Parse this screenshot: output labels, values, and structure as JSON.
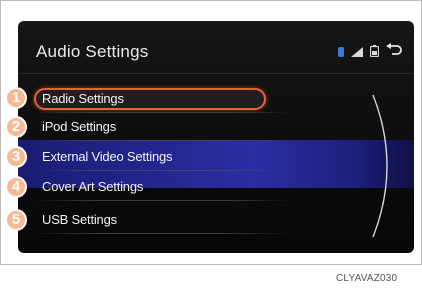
{
  "header": {
    "title": "Audio Settings",
    "icons": [
      "bluetooth-icon",
      "signal-strength-icon",
      "phone-battery-icon",
      "back-icon"
    ]
  },
  "menu": {
    "items": [
      {
        "number": "1",
        "label": "Radio Settings"
      },
      {
        "number": "2",
        "label": "iPod Settings"
      },
      {
        "number": "3",
        "label": "External Video Settings"
      },
      {
        "number": "4",
        "label": "Cover Art Settings"
      },
      {
        "number": "5",
        "label": "USB Settings"
      }
    ],
    "selected_index": 0
  },
  "caption": "CLYAVAZ030",
  "colors": {
    "screen_bg": "#0c0c0c",
    "selection_outline": "#e8613b",
    "callout_fill": "#f6b993",
    "highlight_band": "#23268f",
    "text": "#f2f2f2"
  }
}
